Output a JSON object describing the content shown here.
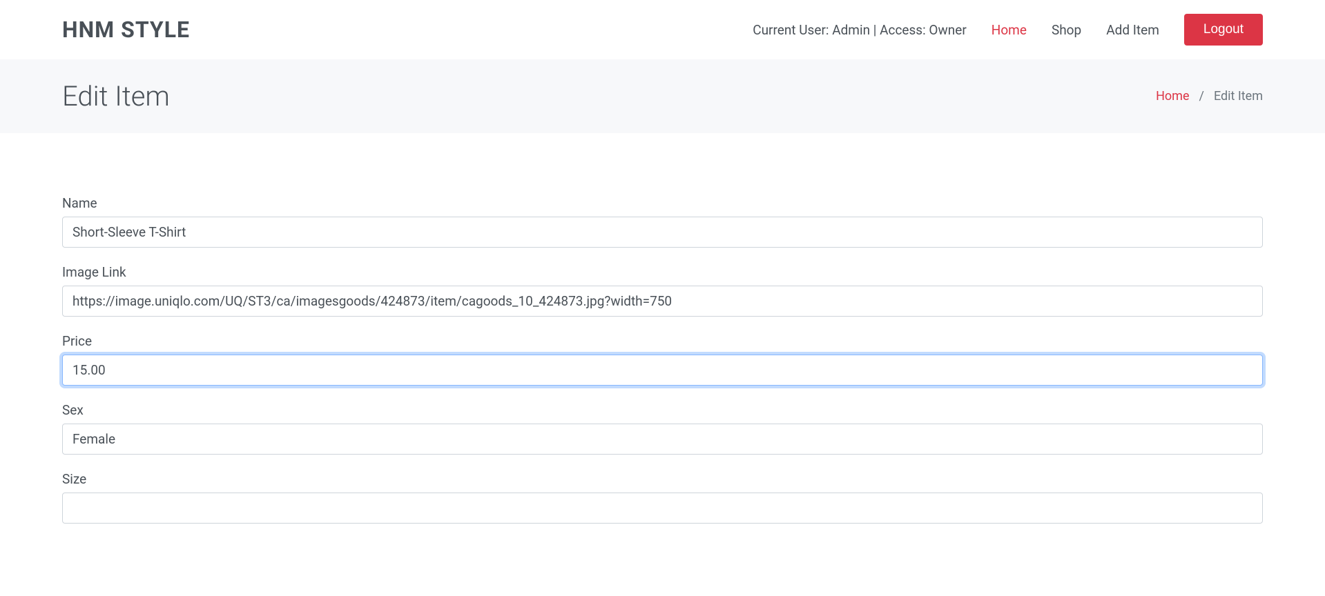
{
  "header": {
    "logo": "HNM STYLE",
    "user_text": "Current User: Admin | Access: Owner",
    "nav": {
      "home": "Home",
      "shop": "Shop",
      "add_item": "Add Item"
    },
    "logout": "Logout"
  },
  "breadcrumb": {
    "title": "Edit Item",
    "home": "Home",
    "separator": "/",
    "current": "Edit Item"
  },
  "form": {
    "name": {
      "label": "Name",
      "value": "Short-Sleeve T-Shirt"
    },
    "image_link": {
      "label": "Image Link",
      "value": "https://image.uniqlo.com/UQ/ST3/ca/imagesgoods/424873/item/cagoods_10_424873.jpg?width=750"
    },
    "price": {
      "label": "Price",
      "value": "15.00"
    },
    "sex": {
      "label": "Sex",
      "value": "Female"
    },
    "size": {
      "label": "Size"
    }
  }
}
